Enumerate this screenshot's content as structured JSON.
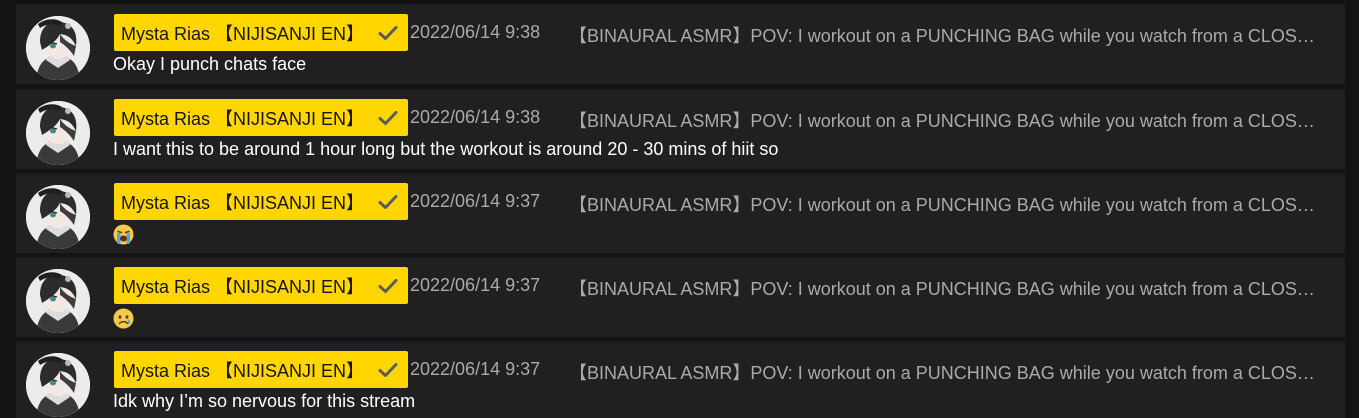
{
  "messages": [
    {
      "author": "Mysta Rias 【NIJISANJI EN】",
      "timestamp": "2022/06/14 9:38",
      "stream_title": "【BINAURAL ASMR】POV: I workout on a PUNCHING BAG while you watch from a CLOSET...",
      "text": "Okay I punch chats face",
      "emoji": ""
    },
    {
      "author": "Mysta Rias 【NIJISANJI EN】",
      "timestamp": "2022/06/14 9:38",
      "stream_title": "【BINAURAL ASMR】POV: I workout on a PUNCHING BAG while you watch from a CLOSET...",
      "text": "I want this to be around 1 hour long but the workout is around 20 - 30 mins of hiit so",
      "emoji": ""
    },
    {
      "author": "Mysta Rias 【NIJISANJI EN】",
      "timestamp": "2022/06/14 9:37",
      "stream_title": "【BINAURAL ASMR】POV: I workout on a PUNCHING BAG while you watch from a CLOSET...",
      "text": "",
      "emoji": "loudly-crying-face-emoji"
    },
    {
      "author": "Mysta Rias 【NIJISANJI EN】",
      "timestamp": "2022/06/14 9:37",
      "stream_title": "【BINAURAL ASMR】POV: I workout on a PUNCHING BAG while you watch from a CLOSET...",
      "text": "",
      "emoji": "sad-tear-face-emoji"
    },
    {
      "author": "Mysta Rias 【NIJISANJI EN】",
      "timestamp": "2022/06/14 9:37",
      "stream_title": "【BINAURAL ASMR】POV: I workout on a PUNCHING BAG while you watch from a CLOSET...",
      "text": "Idk why I’m so nervous for this stream",
      "emoji": ""
    }
  ],
  "icons": {
    "verified": "checkmark-icon",
    "avatar": "user-avatar"
  },
  "colors": {
    "background": "#131313",
    "row_background": "#202020",
    "badge_background": "#ffd600",
    "badge_text": "#151515",
    "meta_text": "#aaaaaa",
    "body_text": "#ffffff",
    "checkmark": "#5c5c5c"
  }
}
